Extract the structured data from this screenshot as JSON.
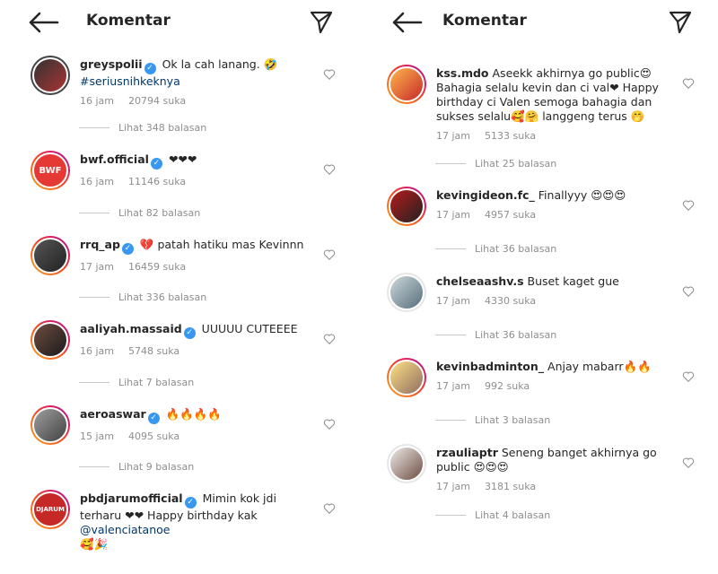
{
  "left": {
    "title": "Komentar",
    "comments": [
      {
        "username": "greyspolii",
        "text": "Ok la cah lanang. 🤣",
        "hashtag": "#seriusnihkeknya",
        "time": "16 jam",
        "likes": "20794 suka",
        "replies": "Lihat 348 balasan"
      },
      {
        "username": "bwf.official",
        "text": "❤❤❤",
        "time": "16 jam",
        "likes": "11146 suka",
        "replies": "Lihat 82 balasan",
        "avatar_text": "BWF"
      },
      {
        "username": "rrq_ap",
        "text": "💔 patah hatiku mas Kevinnn",
        "time": "17 jam",
        "likes": "16459 suka",
        "replies": "Lihat 336 balasan"
      },
      {
        "username": "aaliyah.massaid",
        "text": "UUUUU CUTEEEE",
        "time": "16 jam",
        "likes": "5748 suka",
        "replies": "Lihat 7 balasan"
      },
      {
        "username": "aeroaswar",
        "text": "🔥🔥🔥🔥",
        "time": "15 jam",
        "likes": "4095 suka",
        "replies": "Lihat 9 balasan"
      },
      {
        "username": "pbdjarumofficial",
        "text": "Mimin kok jdi terharu ❤❤ Happy birthday kak",
        "mention": "@valenciatanoe",
        "text_after": "🥰🎉",
        "avatar_text": "DJARUM"
      }
    ]
  },
  "right": {
    "title": "Komentar",
    "comments": [
      {
        "username": "kss.mdo",
        "text": "Aseekk akhirnya go public😍 Bahagia selalu kevin dan ci val❤ Happy birthday ci Valen semoga bahagia dan sukses selalu🥰🤗 langgeng terus 🤭",
        "time": "17 jam",
        "likes": "5133 suka",
        "replies": "Lihat 25 balasan"
      },
      {
        "username": "kevingideon.fc_",
        "text": "Finallyyy 😍😍😍",
        "time": "17 jam",
        "likes": "4957 suka",
        "replies": "Lihat 36 balasan"
      },
      {
        "username": "chelseaashv.s",
        "text": "Buset kaget gue",
        "time": "17 jam",
        "likes": "4330 suka",
        "replies": "Lihat 36 balasan"
      },
      {
        "username": "kevinbadminton_",
        "text": "Anjay mabarr🔥🔥",
        "time": "17 jam",
        "likes": "992 suka",
        "replies": "Lihat 3 balasan"
      },
      {
        "username": "rzauliaptr",
        "text": "Seneng banget akhirnya go public 😍😍😍",
        "time": "17 jam",
        "likes": "3181 suka",
        "replies": "Lihat 4 balasan"
      }
    ]
  },
  "colors": {
    "verified": "#3897f0",
    "link": "#00376b",
    "muted": "#8e8e8e"
  },
  "icons": {
    "back": "arrow-left-icon",
    "send": "paper-plane-icon",
    "like": "heart-icon",
    "verified": "verified-badge-icon"
  }
}
